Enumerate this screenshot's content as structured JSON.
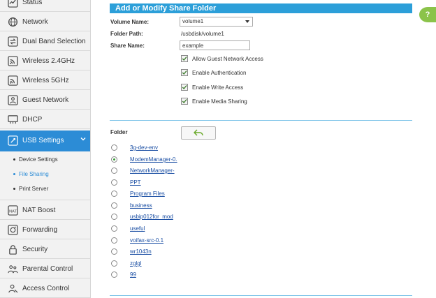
{
  "sidebar": {
    "items": [
      {
        "label": "Status",
        "icon": "status-icon"
      },
      {
        "label": "Network",
        "icon": "globe-icon"
      },
      {
        "label": "Dual Band Selection",
        "icon": "dual-band-icon"
      },
      {
        "label": "Wireless 2.4GHz",
        "icon": "wireless-icon"
      },
      {
        "label": "Wireless 5GHz",
        "icon": "wireless-icon"
      },
      {
        "label": "Guest Network",
        "icon": "guest-icon"
      },
      {
        "label": "DHCP",
        "icon": "dhcp-icon"
      },
      {
        "label": "USB Settings",
        "icon": "usb-icon"
      },
      {
        "label": "NAT Boost",
        "icon": "nat-icon"
      },
      {
        "label": "Forwarding",
        "icon": "forwarding-icon"
      },
      {
        "label": "Security",
        "icon": "lock-icon"
      },
      {
        "label": "Parental Control",
        "icon": "parental-icon"
      },
      {
        "label": "Access Control",
        "icon": "access-icon"
      }
    ],
    "usb_sub": [
      {
        "label": "Device Settings"
      },
      {
        "label": "File Sharing"
      },
      {
        "label": "Print Server"
      }
    ]
  },
  "main": {
    "section_title": "Add or Modify Share Folder",
    "help_icon": "?",
    "volume_name_label": "Volume Name:",
    "volume_name_value": "volume1",
    "folder_path_label": "Folder Path:",
    "folder_path_value": "/usbdisk/volume1",
    "share_name_label": "Share Name:",
    "share_name_value": "example",
    "options": [
      {
        "label": "Allow Guest Network Access",
        "checked": true
      },
      {
        "label": "Enable Authentication",
        "checked": true
      },
      {
        "label": "Enable Write Access",
        "checked": true
      },
      {
        "label": "Enable Media Sharing",
        "checked": true
      }
    ],
    "folder_label": "Folder",
    "folders": [
      {
        "name": "3g-dev-env",
        "selected": false
      },
      {
        "name": "ModemManager-0.",
        "selected": true
      },
      {
        "name": "NetworkManager-",
        "selected": false
      },
      {
        "name": "PPT",
        "selected": false
      },
      {
        "name": "Program Files",
        "selected": false
      },
      {
        "name": "business",
        "selected": false
      },
      {
        "name": "usbip012for_mod",
        "selected": false
      },
      {
        "name": "useful",
        "selected": false
      },
      {
        "name": "voifax-src-0.1",
        "selected": false
      },
      {
        "name": "wr1043n",
        "selected": false
      },
      {
        "name": "zglgl",
        "selected": false
      },
      {
        "name": "99",
        "selected": false
      }
    ]
  },
  "colors": {
    "accent": "#2c8cd6",
    "bar": "#2c9fd9",
    "help": "#8bc34a",
    "link": "#1a4ea3"
  }
}
